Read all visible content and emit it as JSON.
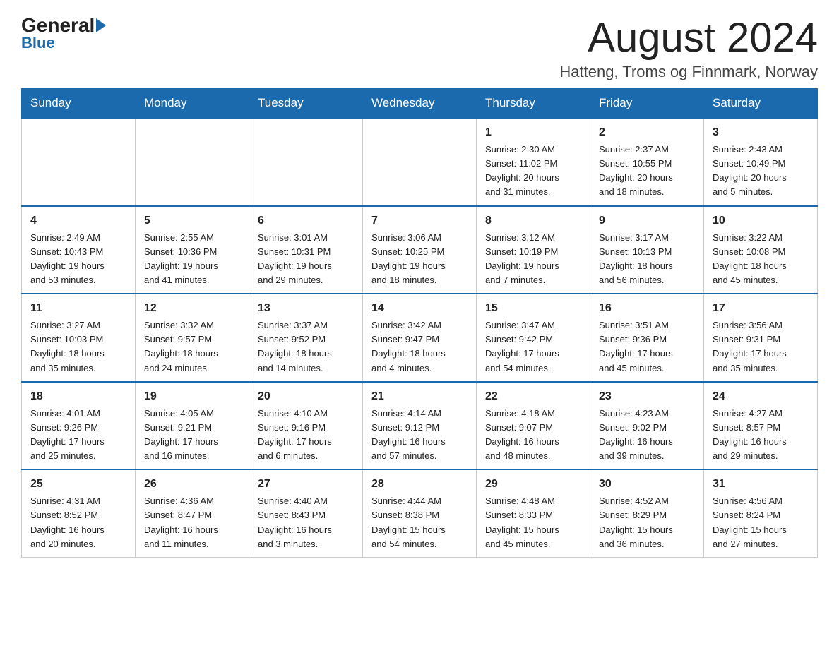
{
  "header": {
    "logo_general": "General",
    "logo_blue": "Blue",
    "month": "August 2024",
    "location": "Hatteng, Troms og Finnmark, Norway"
  },
  "weekdays": [
    "Sunday",
    "Monday",
    "Tuesday",
    "Wednesday",
    "Thursday",
    "Friday",
    "Saturday"
  ],
  "weeks": [
    [
      {
        "day": "",
        "info": ""
      },
      {
        "day": "",
        "info": ""
      },
      {
        "day": "",
        "info": ""
      },
      {
        "day": "",
        "info": ""
      },
      {
        "day": "1",
        "info": "Sunrise: 2:30 AM\nSunset: 11:02 PM\nDaylight: 20 hours\nand 31 minutes."
      },
      {
        "day": "2",
        "info": "Sunrise: 2:37 AM\nSunset: 10:55 PM\nDaylight: 20 hours\nand 18 minutes."
      },
      {
        "day": "3",
        "info": "Sunrise: 2:43 AM\nSunset: 10:49 PM\nDaylight: 20 hours\nand 5 minutes."
      }
    ],
    [
      {
        "day": "4",
        "info": "Sunrise: 2:49 AM\nSunset: 10:43 PM\nDaylight: 19 hours\nand 53 minutes."
      },
      {
        "day": "5",
        "info": "Sunrise: 2:55 AM\nSunset: 10:36 PM\nDaylight: 19 hours\nand 41 minutes."
      },
      {
        "day": "6",
        "info": "Sunrise: 3:01 AM\nSunset: 10:31 PM\nDaylight: 19 hours\nand 29 minutes."
      },
      {
        "day": "7",
        "info": "Sunrise: 3:06 AM\nSunset: 10:25 PM\nDaylight: 19 hours\nand 18 minutes."
      },
      {
        "day": "8",
        "info": "Sunrise: 3:12 AM\nSunset: 10:19 PM\nDaylight: 19 hours\nand 7 minutes."
      },
      {
        "day": "9",
        "info": "Sunrise: 3:17 AM\nSunset: 10:13 PM\nDaylight: 18 hours\nand 56 minutes."
      },
      {
        "day": "10",
        "info": "Sunrise: 3:22 AM\nSunset: 10:08 PM\nDaylight: 18 hours\nand 45 minutes."
      }
    ],
    [
      {
        "day": "11",
        "info": "Sunrise: 3:27 AM\nSunset: 10:03 PM\nDaylight: 18 hours\nand 35 minutes."
      },
      {
        "day": "12",
        "info": "Sunrise: 3:32 AM\nSunset: 9:57 PM\nDaylight: 18 hours\nand 24 minutes."
      },
      {
        "day": "13",
        "info": "Sunrise: 3:37 AM\nSunset: 9:52 PM\nDaylight: 18 hours\nand 14 minutes."
      },
      {
        "day": "14",
        "info": "Sunrise: 3:42 AM\nSunset: 9:47 PM\nDaylight: 18 hours\nand 4 minutes."
      },
      {
        "day": "15",
        "info": "Sunrise: 3:47 AM\nSunset: 9:42 PM\nDaylight: 17 hours\nand 54 minutes."
      },
      {
        "day": "16",
        "info": "Sunrise: 3:51 AM\nSunset: 9:36 PM\nDaylight: 17 hours\nand 45 minutes."
      },
      {
        "day": "17",
        "info": "Sunrise: 3:56 AM\nSunset: 9:31 PM\nDaylight: 17 hours\nand 35 minutes."
      }
    ],
    [
      {
        "day": "18",
        "info": "Sunrise: 4:01 AM\nSunset: 9:26 PM\nDaylight: 17 hours\nand 25 minutes."
      },
      {
        "day": "19",
        "info": "Sunrise: 4:05 AM\nSunset: 9:21 PM\nDaylight: 17 hours\nand 16 minutes."
      },
      {
        "day": "20",
        "info": "Sunrise: 4:10 AM\nSunset: 9:16 PM\nDaylight: 17 hours\nand 6 minutes."
      },
      {
        "day": "21",
        "info": "Sunrise: 4:14 AM\nSunset: 9:12 PM\nDaylight: 16 hours\nand 57 minutes."
      },
      {
        "day": "22",
        "info": "Sunrise: 4:18 AM\nSunset: 9:07 PM\nDaylight: 16 hours\nand 48 minutes."
      },
      {
        "day": "23",
        "info": "Sunrise: 4:23 AM\nSunset: 9:02 PM\nDaylight: 16 hours\nand 39 minutes."
      },
      {
        "day": "24",
        "info": "Sunrise: 4:27 AM\nSunset: 8:57 PM\nDaylight: 16 hours\nand 29 minutes."
      }
    ],
    [
      {
        "day": "25",
        "info": "Sunrise: 4:31 AM\nSunset: 8:52 PM\nDaylight: 16 hours\nand 20 minutes."
      },
      {
        "day": "26",
        "info": "Sunrise: 4:36 AM\nSunset: 8:47 PM\nDaylight: 16 hours\nand 11 minutes."
      },
      {
        "day": "27",
        "info": "Sunrise: 4:40 AM\nSunset: 8:43 PM\nDaylight: 16 hours\nand 3 minutes."
      },
      {
        "day": "28",
        "info": "Sunrise: 4:44 AM\nSunset: 8:38 PM\nDaylight: 15 hours\nand 54 minutes."
      },
      {
        "day": "29",
        "info": "Sunrise: 4:48 AM\nSunset: 8:33 PM\nDaylight: 15 hours\nand 45 minutes."
      },
      {
        "day": "30",
        "info": "Sunrise: 4:52 AM\nSunset: 8:29 PM\nDaylight: 15 hours\nand 36 minutes."
      },
      {
        "day": "31",
        "info": "Sunrise: 4:56 AM\nSunset: 8:24 PM\nDaylight: 15 hours\nand 27 minutes."
      }
    ]
  ]
}
